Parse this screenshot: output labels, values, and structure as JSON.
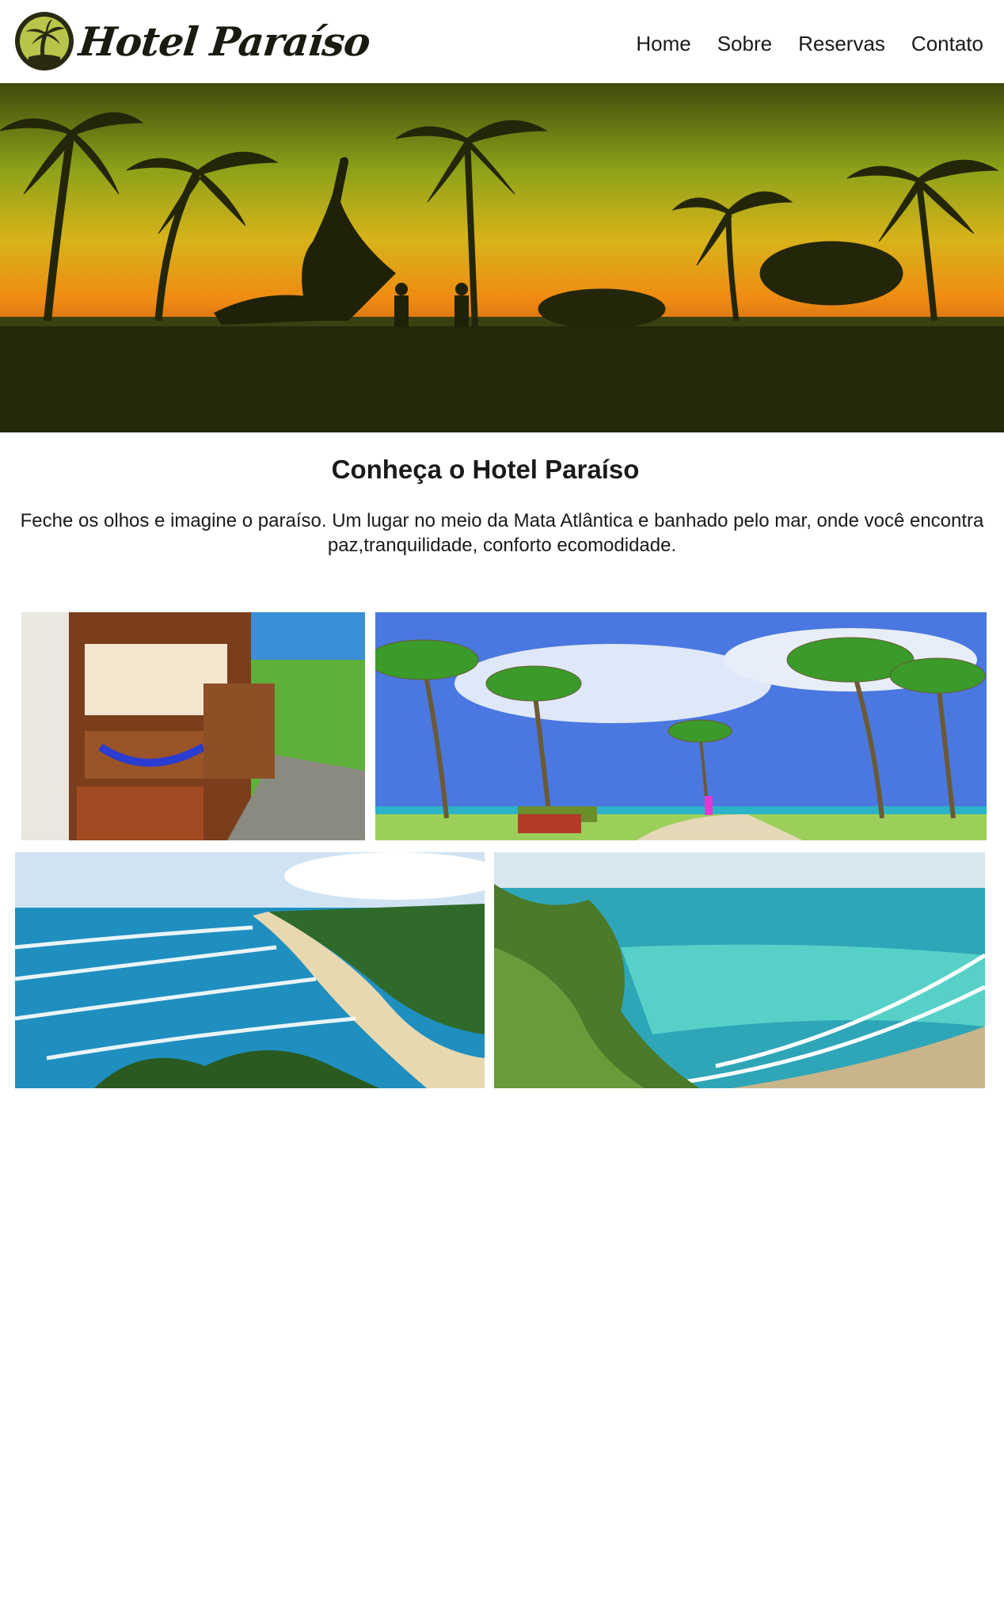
{
  "brand": {
    "name": "Hotel Paraíso",
    "colors": {
      "badge_bg": "#2a2a12",
      "badge_accent": "#b9c54a"
    }
  },
  "nav": {
    "items": [
      {
        "label": "Home"
      },
      {
        "label": "Sobre"
      },
      {
        "label": "Reservas"
      },
      {
        "label": "Contato"
      }
    ]
  },
  "hero": {
    "image": "tropical-sunset-beach-with-palm-trees"
  },
  "intro": {
    "title": "Conheça o Hotel Paraíso",
    "text": "Feche os olhos e imagine o paraíso. Um lugar no meio da Mata Atlântica e banhado pelo mar, onde você encontra paz,tranquilidade, conforto ecomodidade."
  },
  "gallery": [
    {
      "image": "hotel-veranda-with-hammock"
    },
    {
      "image": "palm-grove-beach"
    },
    {
      "image": "aerial-surf-beach-coastline"
    },
    {
      "image": "turquoise-sea-from-cliff"
    }
  ]
}
